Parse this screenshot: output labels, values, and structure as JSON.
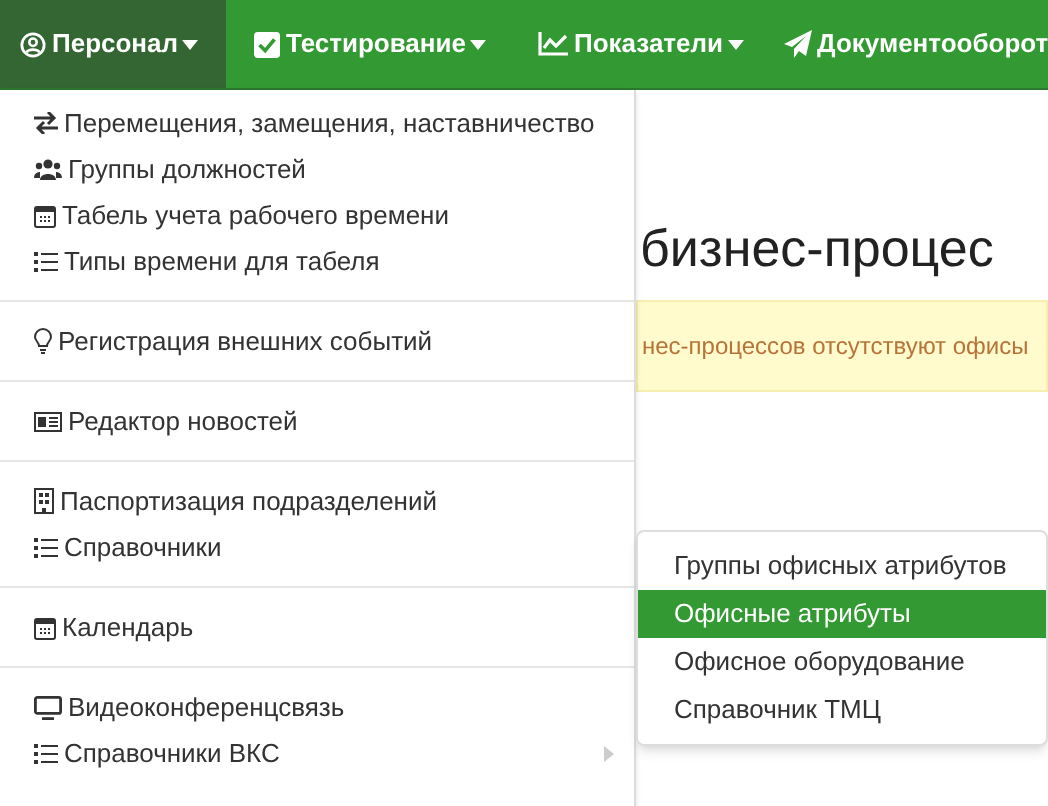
{
  "navbar": {
    "items": [
      {
        "label": "Персонал",
        "selected": true
      },
      {
        "label": "Тестирование",
        "selected": false
      },
      {
        "label": "Показатели",
        "selected": false
      },
      {
        "label": "Документооборот",
        "selected": false
      }
    ]
  },
  "page": {
    "heading": "бизнес-процес",
    "alert": "нес-процессов отсутствуют офисы"
  },
  "dropdown": {
    "sections": [
      {
        "items": [
          {
            "label": "Перемещения, замещения, наставничество",
            "has_submenu": false
          },
          {
            "label": "Группы должностей",
            "has_submenu": false
          },
          {
            "label": "Табель учета рабочего времени",
            "has_submenu": false
          },
          {
            "label": "Типы времени для табеля",
            "has_submenu": false
          }
        ]
      },
      {
        "items": [
          {
            "label": "Регистрация внешних событий",
            "has_submenu": false
          }
        ]
      },
      {
        "items": [
          {
            "label": "Редактор новостей",
            "has_submenu": false
          }
        ]
      },
      {
        "items": [
          {
            "label": "Паспортизация подразделений",
            "has_submenu": false
          },
          {
            "label": "Справочники",
            "has_submenu": false
          }
        ]
      },
      {
        "items": [
          {
            "label": "Календарь",
            "has_submenu": false
          }
        ]
      },
      {
        "items": [
          {
            "label": "Видеоконференцсвязь",
            "has_submenu": false
          },
          {
            "label": "Справочники ВКС",
            "has_submenu": true
          }
        ]
      }
    ]
  },
  "submenu": {
    "items": [
      {
        "label": "Группы офисных атрибутов",
        "selected": false
      },
      {
        "label": "Офисные атрибуты",
        "selected": true
      },
      {
        "label": "Офисное оборудование",
        "selected": false
      },
      {
        "label": "Справочник ТМЦ",
        "selected": false
      }
    ]
  }
}
